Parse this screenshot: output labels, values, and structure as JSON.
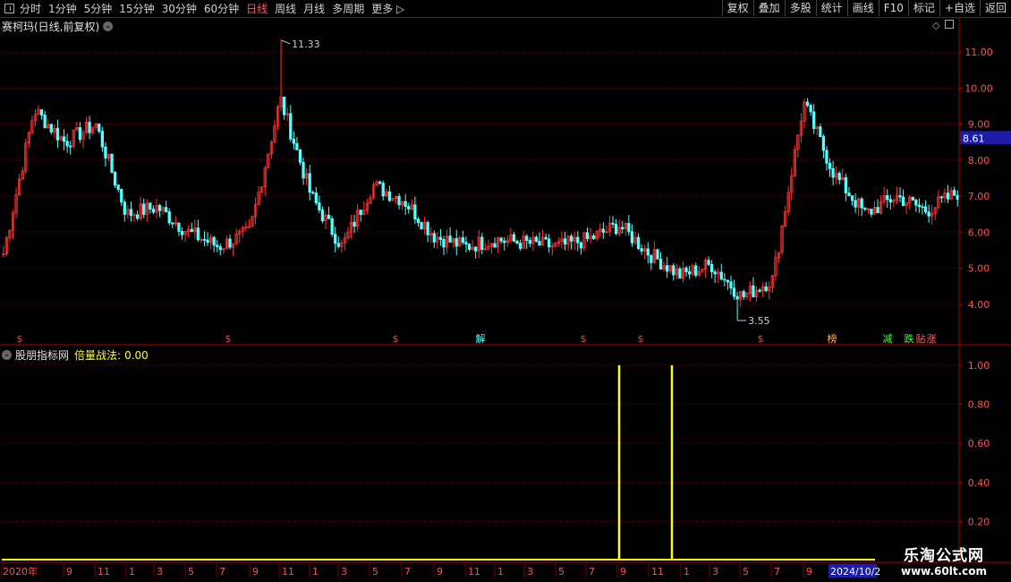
{
  "toolbar": {
    "periods": [
      "分时",
      "1分钟",
      "5分钟",
      "15分钟",
      "30分钟",
      "60分钟",
      "日线",
      "周线",
      "月线",
      "多周期",
      "更多 ▷"
    ],
    "active_period": "日线",
    "right_buttons": [
      "复权",
      "叠加",
      "多股",
      "统计",
      "画线",
      "F10",
      "标记",
      "+自选",
      "返回"
    ]
  },
  "main_panel": {
    "title": "赛柯玛(日线,前复权)",
    "last_price_badge": "8.61",
    "high_label": "11.33",
    "low_label": "3.55",
    "y_ticks": [
      "11.00",
      "10.00",
      "9.00",
      "8.00",
      "7.00",
      "6.00",
      "5.00",
      "4.00"
    ],
    "markers": [
      "$",
      "$",
      "$",
      "解",
      "$",
      "$",
      "$",
      "榜",
      "减",
      "跌",
      "贴",
      "涨"
    ],
    "colors": {
      "up": "#ff3232",
      "down": "#54ffff",
      "grid": "#7a0000",
      "axis": "#b00000",
      "badge": "#1c1ca8"
    }
  },
  "indicator_panel": {
    "name": "股朋指标网",
    "formula_label": "倍量战法:",
    "formula_value": "0.00",
    "y_ticks": [
      "1.00",
      "0.80",
      "0.60",
      "0.40",
      "0.20"
    ],
    "signal_color": "#ffff00"
  },
  "time_axis": {
    "labels": [
      "2020年",
      "9",
      "11",
      "1",
      "3",
      "5",
      "7",
      "9",
      "11",
      "1",
      "3",
      "5",
      "7",
      "9",
      "11",
      "1",
      "3",
      "5",
      "7",
      "9",
      "11",
      "1",
      "3",
      "5",
      "7",
      "9"
    ],
    "current_date": "2024/10/2"
  },
  "watermark": {
    "line1": "乐淘公式网",
    "line2": "www.60lt.com"
  },
  "chart_data": [
    {
      "type": "candlestick",
      "title": "赛柯玛(日线,前复权)",
      "ylim": [
        3.3,
        11.5
      ],
      "high": 11.33,
      "low": 3.55,
      "last": 8.61,
      "x": [
        "2020年",
        "9",
        "11",
        "1",
        "3",
        "5",
        "7",
        "9",
        "11",
        "1",
        "3",
        "5",
        "7",
        "9",
        "11",
        "1",
        "3",
        "5",
        "7",
        "9",
        "11",
        "1",
        "3",
        "5",
        "7",
        "9",
        "2024/10/2"
      ],
      "close_approx": [
        5.4,
        9.4,
        8.5,
        9.0,
        6.5,
        6.7,
        6.0,
        5.6,
        6.0,
        9.7,
        7.0,
        5.6,
        7.3,
        6.9,
        5.9,
        5.6,
        5.8,
        5.7,
        5.6,
        5.8,
        6.2,
        5.4,
        4.8,
        5.1,
        4.2,
        4.7,
        9.6,
        7.6,
        6.5,
        7.0,
        6.6,
        7.1
      ]
    },
    {
      "type": "bar",
      "title": "倍量战法",
      "ylim": [
        0,
        1.05
      ],
      "signals": [
        {
          "x": "9",
          "value": 1.0
        },
        {
          "x": "12",
          "value": 1.0
        }
      ],
      "baseline": 0.0
    }
  ]
}
